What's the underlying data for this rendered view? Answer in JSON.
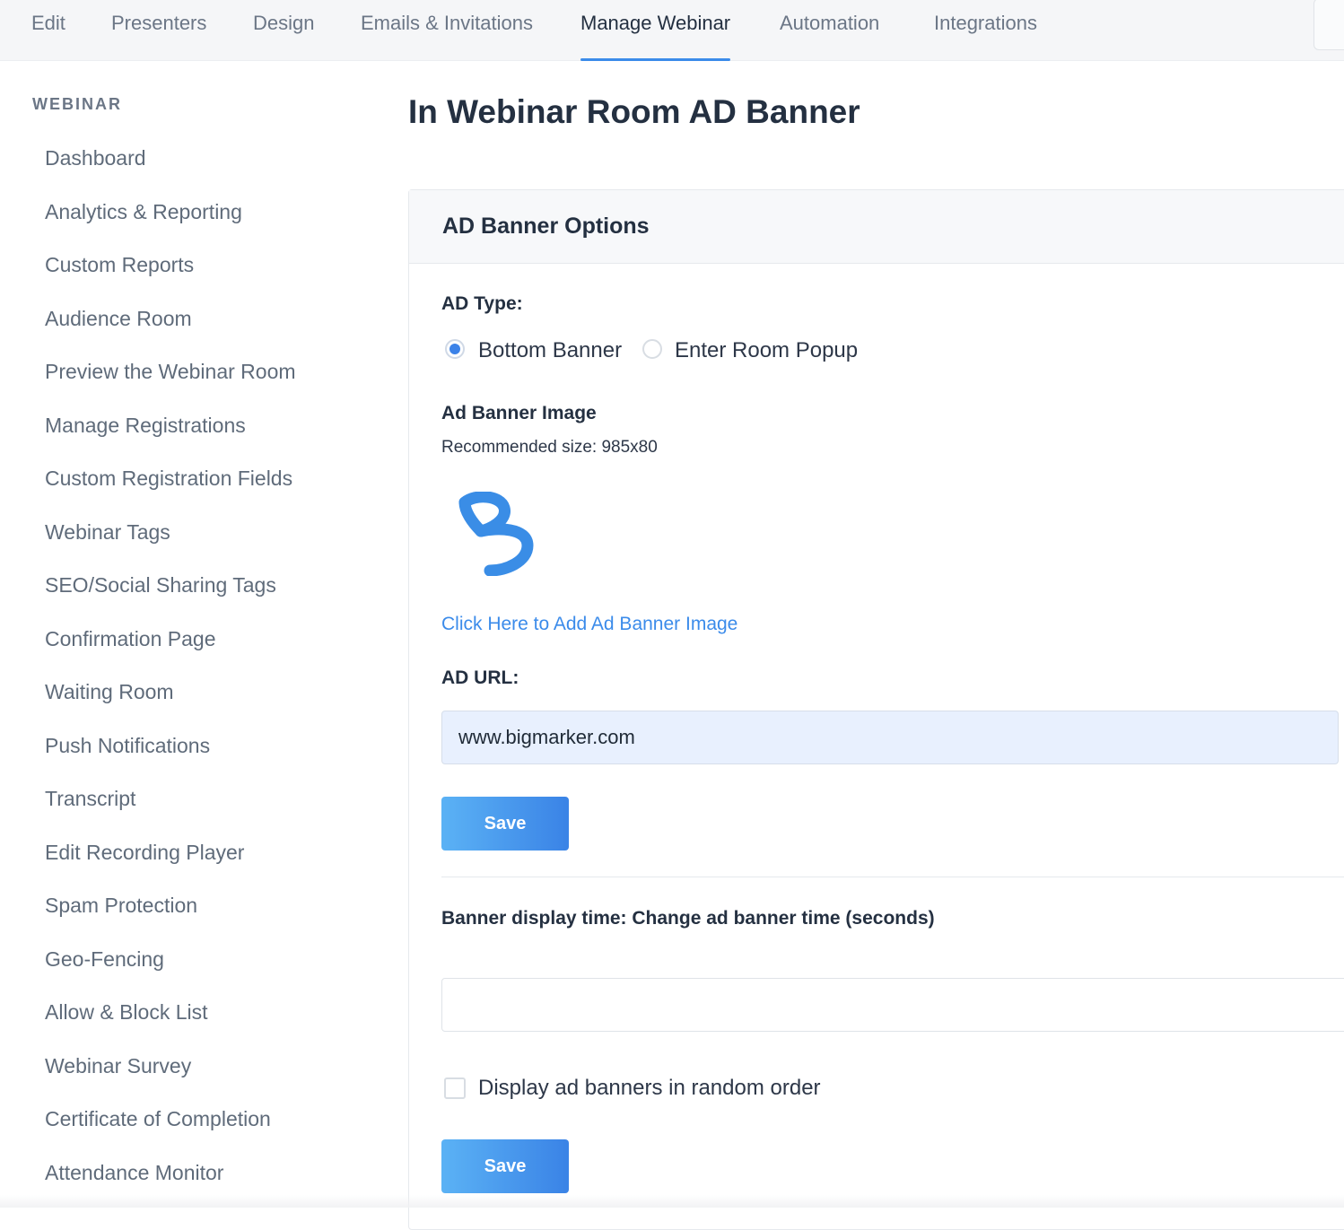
{
  "nav": {
    "tabs": [
      {
        "label": "Edit"
      },
      {
        "label": "Presenters"
      },
      {
        "label": "Design"
      },
      {
        "label": "Emails & Invitations"
      },
      {
        "label": "Manage Webinar",
        "active": true
      },
      {
        "label": "Automation"
      },
      {
        "label": "Integrations"
      }
    ]
  },
  "sidebar": {
    "heading": "WEBINAR",
    "items": [
      {
        "label": "Dashboard"
      },
      {
        "label": "Analytics & Reporting"
      },
      {
        "label": "Custom Reports"
      },
      {
        "label": "Audience Room"
      },
      {
        "label": "Preview the Webinar Room"
      },
      {
        "label": "Manage Registrations"
      },
      {
        "label": "Custom Registration Fields"
      },
      {
        "label": "Webinar Tags"
      },
      {
        "label": "SEO/Social Sharing Tags"
      },
      {
        "label": "Confirmation Page"
      },
      {
        "label": "Waiting Room"
      },
      {
        "label": "Push Notifications"
      },
      {
        "label": "Transcript"
      },
      {
        "label": "Edit Recording Player"
      },
      {
        "label": "Spam Protection"
      },
      {
        "label": "Geo-Fencing"
      },
      {
        "label": "Allow & Block List"
      },
      {
        "label": "Webinar Survey"
      },
      {
        "label": "Certificate of Completion"
      },
      {
        "label": "Attendance Monitor"
      }
    ]
  },
  "main": {
    "title": "In Webinar Room AD Banner",
    "card_title": "AD Banner Options",
    "ad_type": {
      "label": "AD Type:",
      "options": [
        {
          "label": "Bottom Banner",
          "selected": true
        },
        {
          "label": "Enter Room Popup",
          "selected": false
        }
      ]
    },
    "image": {
      "label": "Ad Banner Image",
      "hint": "Recommended size: 985x80",
      "preview_icon": "bigmarker-logo-icon",
      "add_link": "Click Here to Add Ad Banner Image"
    },
    "ad_url": {
      "label": "AD URL:",
      "value": "www.bigmarker.com"
    },
    "save_label": "Save",
    "display_time": {
      "label": "Banner display time: Change ad banner time (seconds)",
      "value": ""
    },
    "random_order": {
      "label": "Display ad banners in random order",
      "checked": false
    }
  },
  "colors": {
    "accent": "#3b8bea",
    "button_start": "#5bb2f5",
    "button_end": "#3a83e6",
    "text": "#243041",
    "muted": "#6b7686"
  }
}
